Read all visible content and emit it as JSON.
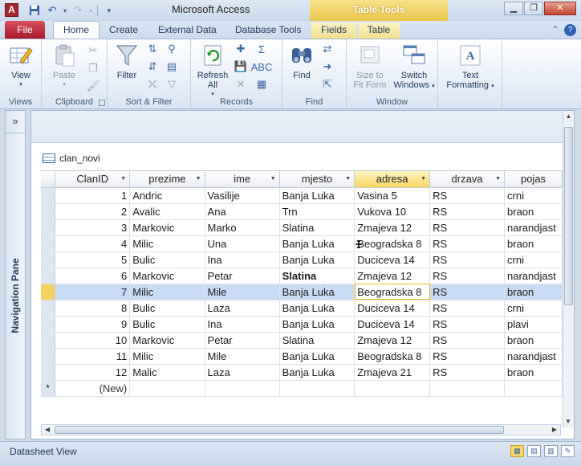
{
  "window": {
    "title": "Microsoft Access",
    "contextual_tab_group": "Table Tools",
    "app_icon_letter": "A",
    "controls": [
      "minimize-icon",
      "restore-icon",
      "close-icon"
    ]
  },
  "quick_access": [
    "save-icon",
    "undo-icon",
    "redo-icon",
    "customize-icon"
  ],
  "tabs": [
    {
      "label": "File"
    },
    {
      "label": "Home"
    },
    {
      "label": "Create"
    },
    {
      "label": "External Data"
    },
    {
      "label": "Database Tools"
    },
    {
      "label": "Fields"
    },
    {
      "label": "Table"
    }
  ],
  "ribbon": {
    "views": {
      "label": "Views",
      "view_button": "View"
    },
    "clipboard": {
      "label": "Clipboard",
      "paste_button": "Paste"
    },
    "sort_filter": {
      "label": "Sort & Filter",
      "filter_button": "Filter"
    },
    "records": {
      "label": "Records",
      "refresh_button": "Refresh All"
    },
    "find": {
      "label": "Find",
      "find_button": "Find"
    },
    "window": {
      "label": "Window",
      "size_to_fit_line1": "Size to",
      "size_to_fit_line2": "Fit Form",
      "switch_line1": "Switch",
      "switch_line2": "Windows"
    },
    "text_formatting": {
      "line1": "Text",
      "line2": "Formatting"
    }
  },
  "nav_pane": {
    "label": "Navigation Pane",
    "toggle": "»"
  },
  "document": {
    "tab_label": "clan_novi"
  },
  "table": {
    "columns": [
      "ClanID",
      "prezime",
      "ime",
      "mjesto",
      "adresa",
      "drzava",
      "pojas"
    ],
    "selected_column": "adresa",
    "rows": [
      [
        "1",
        "Andric",
        "Vasilije",
        "Banja Luka",
        "Vasina 5",
        "RS",
        "crni"
      ],
      [
        "2",
        "Avalic",
        "Ana",
        "Trn",
        "Vukova 10",
        "RS",
        "braon"
      ],
      [
        "3",
        "Markovic",
        "Marko",
        "Slatina",
        "Zmajeva 12",
        "RS",
        "narandjast"
      ],
      [
        "4",
        "Milic",
        "Una",
        "Banja Luka",
        "Beogradska 8",
        "RS",
        "braon"
      ],
      [
        "5",
        "Bulic",
        "Ina",
        "Banja Luka",
        "Duciceva 14",
        "RS",
        "crni"
      ],
      [
        "6",
        "Markovic",
        "Petar",
        "Slatina",
        "Zmajeva 12",
        "RS",
        "narandjast"
      ],
      [
        "7",
        "Milic",
        "Mile",
        "Banja Luka",
        "Beogradska 8",
        "RS",
        "braon"
      ],
      [
        "8",
        "Bulic",
        "Laza",
        "Banja Luka",
        "Duciceva 14",
        "RS",
        "crni"
      ],
      [
        "9",
        "Bulic",
        "Ina",
        "Banja Luka",
        "Duciceva 14",
        "RS",
        "plavi"
      ],
      [
        "10",
        "Markovic",
        "Petar",
        "Slatina",
        "Zmajeva 12",
        "RS",
        "braon"
      ],
      [
        "11",
        "Milic",
        "Mile",
        "Banja Luka",
        "Beogradska 8",
        "RS",
        "narandjast"
      ],
      [
        "12",
        "Malic",
        "Laza",
        "Banja Luka",
        "Zmajeva 21",
        "RS",
        "braon"
      ]
    ],
    "current_row_index": 6,
    "new_row_marker": "*",
    "new_row_label": "(New)"
  },
  "status": {
    "text": "Datasheet View"
  },
  "colors": {
    "accent": "#2a5a9c",
    "file_tab": "#b62a39",
    "contextual": "#e9c64b",
    "selected_row": "#c8ddf5"
  }
}
